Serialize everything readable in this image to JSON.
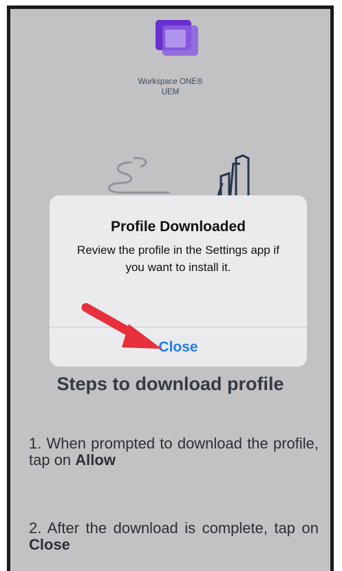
{
  "app": {
    "brand_line1": "Workspace ONE®",
    "brand_line2": "UEM"
  },
  "dialog": {
    "title": "Profile Downloaded",
    "message": "Review the profile in the Settings app if you want to install it.",
    "button_label": "Close",
    "button_color": "#1b7cf3"
  },
  "steps": {
    "title": "Steps to download profile",
    "step1_text": "1. When prompted to download the profile, tap on",
    "step1_bold": "Allow",
    "step2_text": "2. After the download is complete, tap on",
    "step2_bold": "Close"
  },
  "annotation": {
    "arrow_color": "#e8303c"
  },
  "icons": {
    "logo": "workspace-one-logo-icon",
    "illustration": "books-illustration-icon",
    "pointer": "red-arrow-icon"
  }
}
